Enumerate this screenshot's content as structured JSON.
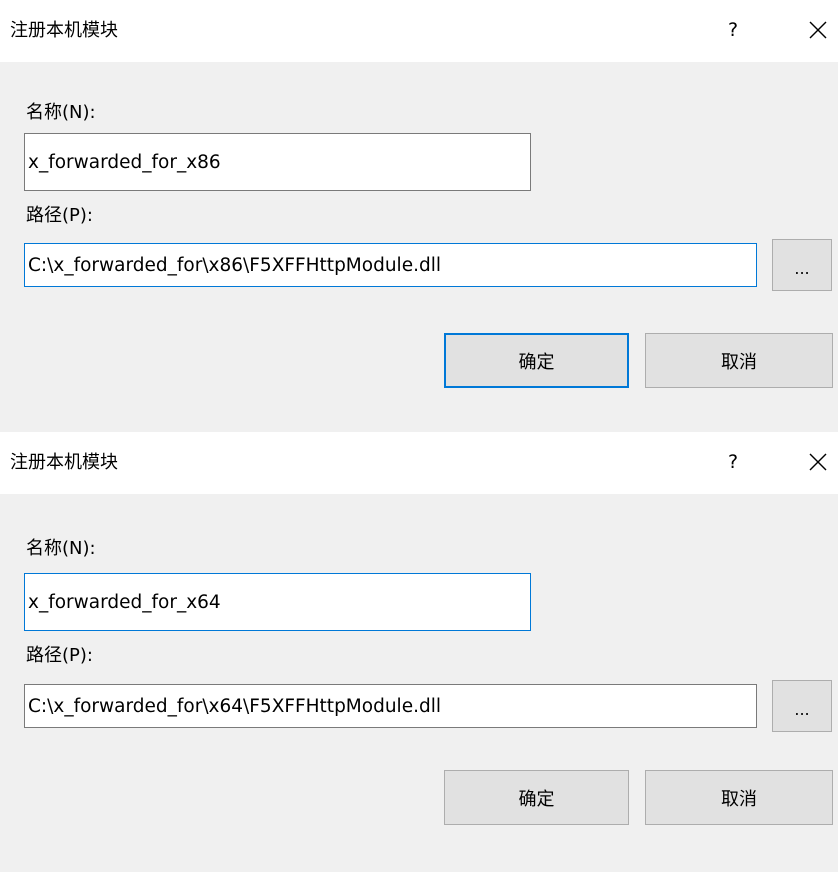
{
  "dialogs": [
    {
      "title": "注册本机模块",
      "help": "?",
      "name_label": "名称(N):",
      "name_value": "x_forwarded_for_x86",
      "path_label": "路径(P):",
      "path_value": "C:\\x_forwarded_for\\x86\\F5XFFHttpModule.dll",
      "browse": "...",
      "ok": "确定",
      "cancel": "取消"
    },
    {
      "title": "注册本机模块",
      "help": "?",
      "name_label": "名称(N):",
      "name_value": "x_forwarded_for_x64",
      "path_label": "路径(P):",
      "path_value": "C:\\x_forwarded_for\\x64\\F5XFFHttpModule.dll",
      "browse": "...",
      "ok": "确定",
      "cancel": "取消"
    }
  ],
  "colors": {
    "dialog_background": "#f0f0f0",
    "focus_accent": "#0078d7",
    "button_face": "#e1e1e1"
  },
  "icons": {
    "close": "close-x-icon"
  }
}
